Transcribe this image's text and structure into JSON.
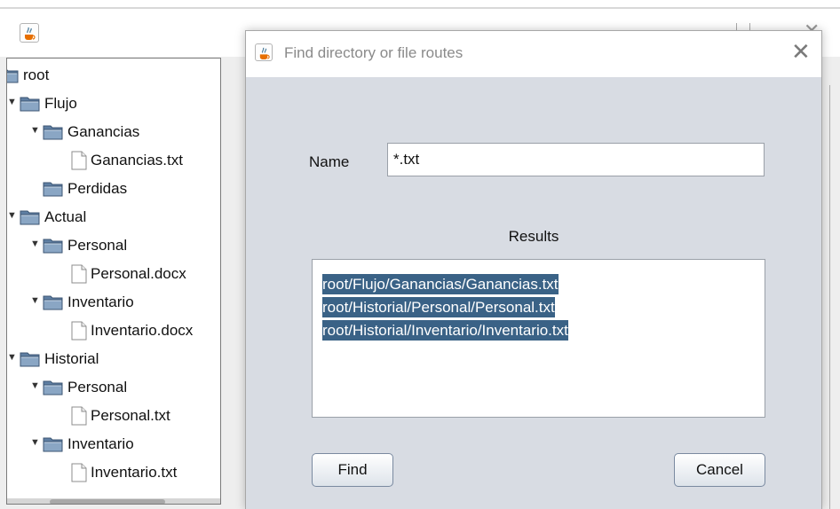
{
  "main_window": {
    "tree": [
      {
        "label": "root",
        "type": "folder",
        "depth": 0,
        "toggle": ""
      },
      {
        "label": "Flujo",
        "type": "folder",
        "depth": 1,
        "toggle": "▼"
      },
      {
        "label": "Ganancias",
        "type": "folder",
        "depth": 2,
        "toggle": "▼"
      },
      {
        "label": "Ganancias.txt",
        "type": "file",
        "depth": 3,
        "toggle": ""
      },
      {
        "label": "Perdidas",
        "type": "folder",
        "depth": 2,
        "toggle": ""
      },
      {
        "label": "Actual",
        "type": "folder",
        "depth": 1,
        "toggle": "▼"
      },
      {
        "label": "Personal",
        "type": "folder",
        "depth": 2,
        "toggle": "▼"
      },
      {
        "label": "Personal.docx",
        "type": "file",
        "depth": 3,
        "toggle": ""
      },
      {
        "label": "Inventario",
        "type": "folder",
        "depth": 2,
        "toggle": "▼"
      },
      {
        "label": "Inventario.docx",
        "type": "file",
        "depth": 3,
        "toggle": ""
      },
      {
        "label": "Historial",
        "type": "folder",
        "depth": 1,
        "toggle": "▼"
      },
      {
        "label": "Personal",
        "type": "folder",
        "depth": 2,
        "toggle": "▼"
      },
      {
        "label": "Personal.txt",
        "type": "file",
        "depth": 3,
        "toggle": ""
      },
      {
        "label": "Inventario",
        "type": "folder",
        "depth": 2,
        "toggle": "▼"
      },
      {
        "label": "Inventario.txt",
        "type": "file",
        "depth": 3,
        "toggle": ""
      }
    ]
  },
  "dialog": {
    "title": "Find directory or file routes",
    "close_glyph": "✕",
    "name_label": "Name",
    "name_value": "*.txt",
    "results_label": "Results",
    "results": [
      "root/Flujo/Ganancias/Ganancias.txt",
      "root/Historial/Personal/Personal.txt",
      "root/Historial/Inventario/Inventario.txt"
    ],
    "find_label": "Find",
    "cancel_label": "Cancel"
  },
  "colors": {
    "dialog_background": "#d8dce3",
    "selection": "#3a6286",
    "folder": "#5f7fa3"
  },
  "icons": {
    "app": "java-cup-icon",
    "folder": "folder-icon",
    "file": "file-icon",
    "expanded": "triangle-down-icon"
  }
}
